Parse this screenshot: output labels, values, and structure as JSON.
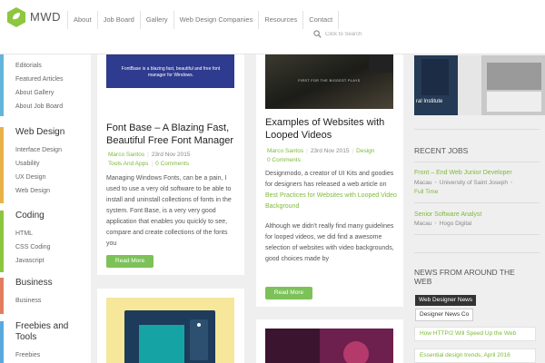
{
  "brand": {
    "name": "MWD",
    "accent": "#8ec63f"
  },
  "nav": [
    "About",
    "Job Board",
    "Gallery",
    "Web Design Companies",
    "Resources",
    "Contact"
  ],
  "search": {
    "placeholder": "Click to Search"
  },
  "sidebar": {
    "categories": [
      {
        "title": "",
        "color": "#64b5d9",
        "links": [
          "Editorials",
          "Featured Articles",
          "About Gallery",
          "About Job Board"
        ]
      },
      {
        "title": "Web Design",
        "color": "#e8b248",
        "links": [
          "Interface Design",
          "Usability",
          "UX Design",
          "Web Design"
        ]
      },
      {
        "title": "Coding",
        "color": "#8cc63f",
        "links": [
          "HTML",
          "CSS Coding",
          "Javascript"
        ]
      },
      {
        "title": "Business",
        "color": "#e27d60",
        "links": [
          "Business"
        ]
      },
      {
        "title": "Freebies and Tools",
        "color": "#5aa9de",
        "links": [
          "Freebies"
        ]
      }
    ]
  },
  "posts": [
    {
      "title": "Font Base – A Blazing Fast, Beautiful Free Font Manager",
      "image_text": "FontBase is a blazing fast, beautiful and free font manager for Windows.",
      "author": "Marco Santos",
      "date": "23rd Nov 2015",
      "category": "Tools And Apps",
      "comments": "0 Comments",
      "excerpt": "Managing Windows Fonts, can be a pain, I used to use a very old software to be able to install and uninstall collections of fonts in the system. Font Base, is a very very good application that enables you quickly to see, compare and create collections of the fonts you",
      "button": "Read More"
    },
    {
      "title": "Examples of Websites with Looped Videos",
      "image_text": "FIRST FOR THE BIGGEST PLAYS",
      "author": "Marco Santos",
      "date": "23rd Nov 2015",
      "category": "Design",
      "comments": "0 Comments",
      "excerpt_intro": "Designmodo, a creator of UI Kits and goodies for designers has released a web article on",
      "excerpt_link": "Best Practices for Websites with Looped Video Background",
      "excerpt_more": "Although we didn't really find many guidelines for looped videos, we did find a awesome selection of websites with video backgrounds, good choices made by",
      "button": "Read More"
    }
  ],
  "right": {
    "image_caption": "ral Institute",
    "recent_jobs_title": "RECENT JOBS",
    "jobs": [
      {
        "title": "Front – End Web Junior Developer",
        "location": "Macau",
        "company": "University of Saint Joseph",
        "type": "Full Time"
      },
      {
        "title": "Senior Software Analyst",
        "location": "Macau",
        "company": "Hogo Digital"
      }
    ],
    "news_title": "NEWS FROM AROUND THE WEB",
    "news_tabs": [
      "Web Designer News",
      "Designer News Co"
    ],
    "news_links": [
      "How HTTP/2 Will Speed Up the Web",
      "Essential design trends, April 2016"
    ]
  }
}
